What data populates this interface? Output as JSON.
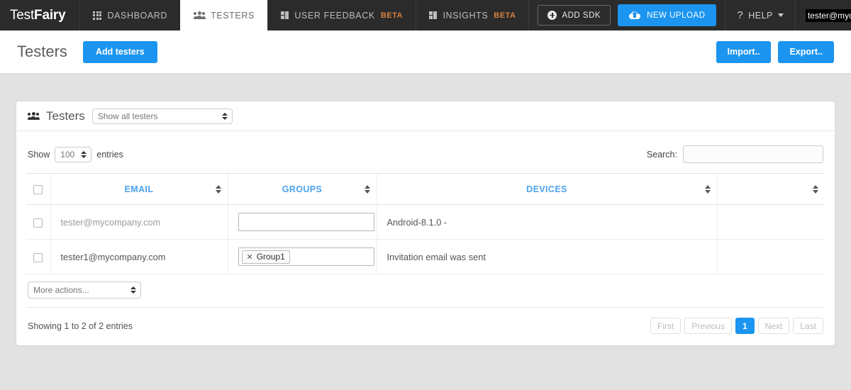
{
  "topnav": {
    "brand": {
      "part1": "Test",
      "part2": "Fairy"
    },
    "items": [
      {
        "label": "DASHBOARD",
        "icon": "grid-icon",
        "active": false,
        "beta": ""
      },
      {
        "label": "TESTERS",
        "icon": "people-icon",
        "active": true,
        "beta": ""
      },
      {
        "label": "USER FEEDBACK",
        "icon": "blocks-icon",
        "active": false,
        "beta": "BETA"
      },
      {
        "label": "INSIGHTS",
        "icon": "blocks-icon",
        "active": false,
        "beta": "BETA"
      }
    ],
    "add_sdk_label": "ADD SDK",
    "new_upload_label": "NEW UPLOAD",
    "help_label": "HELP",
    "user_email": "tester@mycompany.com",
    "bell_icon": "bell-icon"
  },
  "subheader": {
    "title": "Testers",
    "add_testers_label": "Add testers",
    "import_label": "Import..",
    "export_label": "Export.."
  },
  "panel": {
    "title": "Testers",
    "filter_selected": "Show all testers",
    "filter_options": [
      "Show all testers"
    ],
    "length_prefix": "Show",
    "length_value": "100",
    "length_options": [
      "100"
    ],
    "length_suffix": "entries",
    "search_label": "Search:",
    "search_value": "",
    "table": {
      "columns": [
        "EMAIL",
        "GROUPS",
        "DEVICES",
        ""
      ],
      "rows": [
        {
          "checked": false,
          "email": "tester@mycompany.com",
          "email_muted": true,
          "groups": [],
          "devices": "Android-8.1.0 -",
          "extra": ""
        },
        {
          "checked": false,
          "email": "tester1@mycompany.com",
          "email_muted": false,
          "groups": [
            "Group1"
          ],
          "devices": "Invitation email was sent",
          "extra": ""
        }
      ]
    },
    "more_actions_selected": "More actions...",
    "more_actions_options": [
      "More actions..."
    ],
    "showing_text": "Showing 1 to 2 of 2 entries",
    "pagination": {
      "first": "First",
      "previous": "Previous",
      "pages": [
        "1"
      ],
      "active_page": "1",
      "next": "Next",
      "last": "Last"
    }
  },
  "colors": {
    "accent": "#1b95f0",
    "nav_bg": "#2b2b2b",
    "page_bg": "#e2e2e2",
    "beta": "#d9803f",
    "header_link": "#4da3ef"
  }
}
